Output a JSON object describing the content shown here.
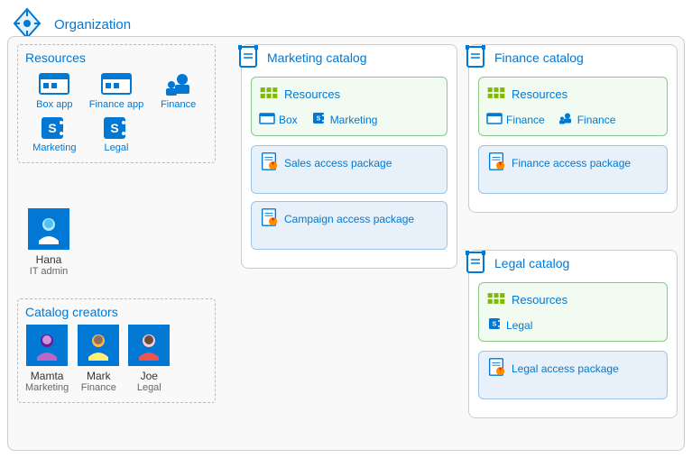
{
  "header": {
    "title": "Organization"
  },
  "resources": {
    "title": "Resources",
    "items": [
      {
        "label": "Box app"
      },
      {
        "label": "Finance app"
      },
      {
        "label": "Finance"
      },
      {
        "label": "Marketing"
      },
      {
        "label": "Legal"
      }
    ]
  },
  "admin": {
    "name": "Hana",
    "role": "IT admin"
  },
  "creators": {
    "title": "Catalog creators",
    "people": [
      {
        "name": "Mamta",
        "role": "Marketing"
      },
      {
        "name": "Mark",
        "role": "Finance"
      },
      {
        "name": "Joe",
        "role": "Legal"
      }
    ]
  },
  "catalogs": [
    {
      "title": "Marketing catalog",
      "resources_label": "Resources",
      "resources": [
        {
          "label": "Box"
        },
        {
          "label": "Marketing"
        }
      ],
      "packages": [
        {
          "label": "Sales access package"
        },
        {
          "label": "Campaign access package"
        }
      ]
    },
    {
      "title": "Finance catalog",
      "resources_label": "Resources",
      "resources": [
        {
          "label": "Finance"
        },
        {
          "label": "Finance"
        }
      ],
      "packages": [
        {
          "label": "Finance access package"
        }
      ]
    },
    {
      "title": "Legal catalog",
      "resources_label": "Resources",
      "resources": [
        {
          "label": "Legal"
        }
      ],
      "packages": [
        {
          "label": "Legal access package"
        }
      ]
    }
  ]
}
